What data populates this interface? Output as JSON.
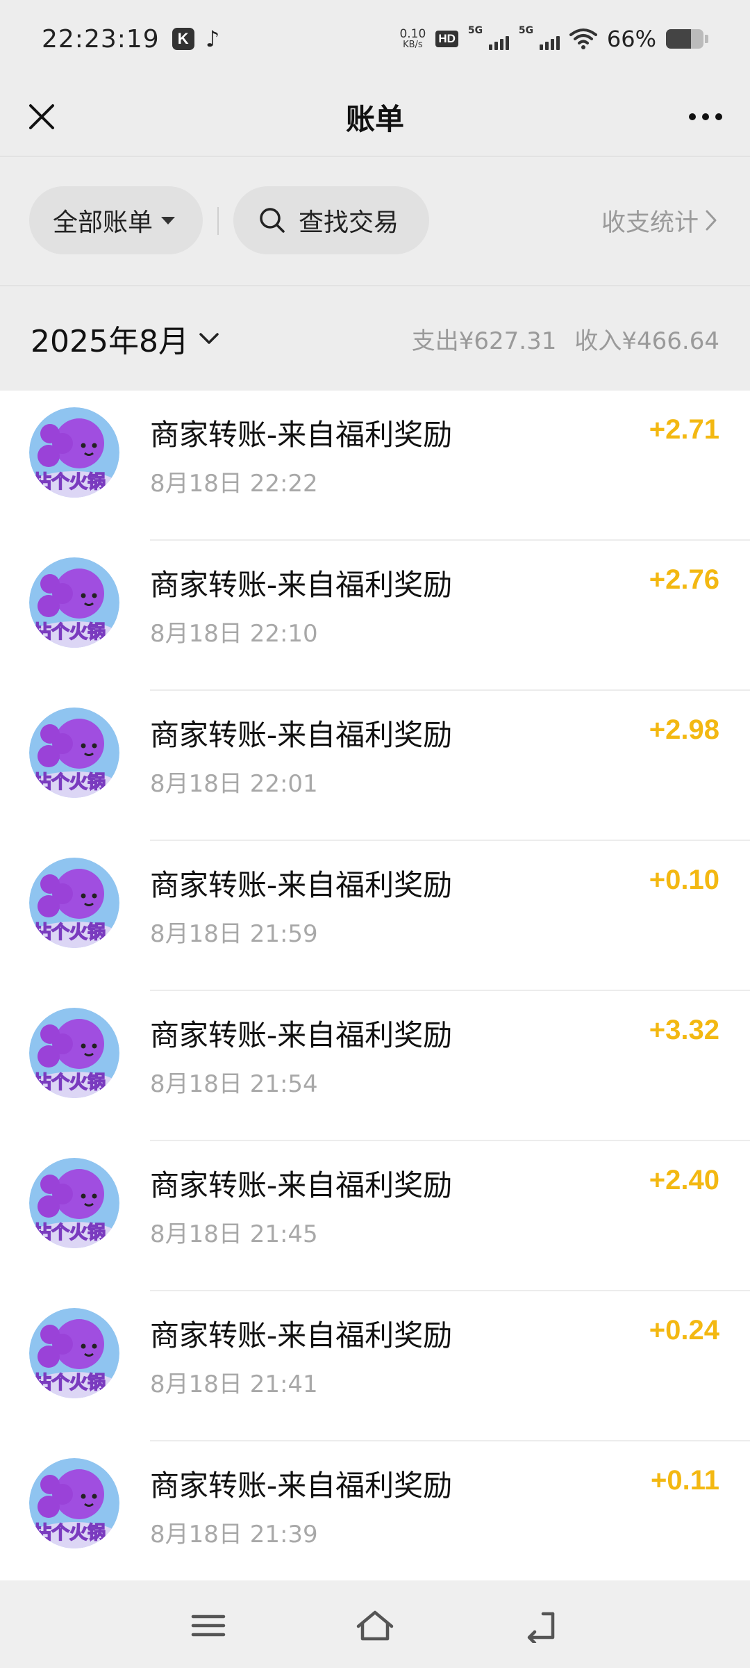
{
  "status_bar": {
    "time": "22:23:19",
    "net_speed_value": "0.10",
    "net_speed_unit": "KB/s",
    "hd_badge": "HD",
    "signal_1_label": "5G",
    "signal_2_label": "5G",
    "battery_percent": "66%",
    "battery_level": 0.66
  },
  "nav": {
    "title": "账单"
  },
  "filters": {
    "all_bills": "全部账单",
    "search": "查找交易",
    "stats": "收支统计"
  },
  "month": {
    "label": "2025年8月",
    "expense": "支出¥627.31",
    "income": "收入¥466.64"
  },
  "colors": {
    "income_amount": "#f3b812",
    "avatar_bg": "#8fc4f0",
    "avatar_character": "#a04ee0"
  },
  "transactions": [
    {
      "title": "商家转账-来自福利奖励",
      "time": "8月18日 22:22",
      "amount": "+2.71"
    },
    {
      "title": "商家转账-来自福利奖励",
      "time": "8月18日 22:10",
      "amount": "+2.76"
    },
    {
      "title": "商家转账-来自福利奖励",
      "time": "8月18日 22:01",
      "amount": "+2.98"
    },
    {
      "title": "商家转账-来自福利奖励",
      "time": "8月18日 21:59",
      "amount": "+0.10"
    },
    {
      "title": "商家转账-来自福利奖励",
      "time": "8月18日 21:54",
      "amount": "+3.32"
    },
    {
      "title": "商家转账-来自福利奖励",
      "time": "8月18日 21:45",
      "amount": "+2.40"
    },
    {
      "title": "商家转账-来自福利奖励",
      "time": "8月18日 21:41",
      "amount": "+0.24"
    },
    {
      "title": "商家转账-来自福利奖励",
      "time": "8月18日 21:39",
      "amount": "+0.11"
    }
  ]
}
